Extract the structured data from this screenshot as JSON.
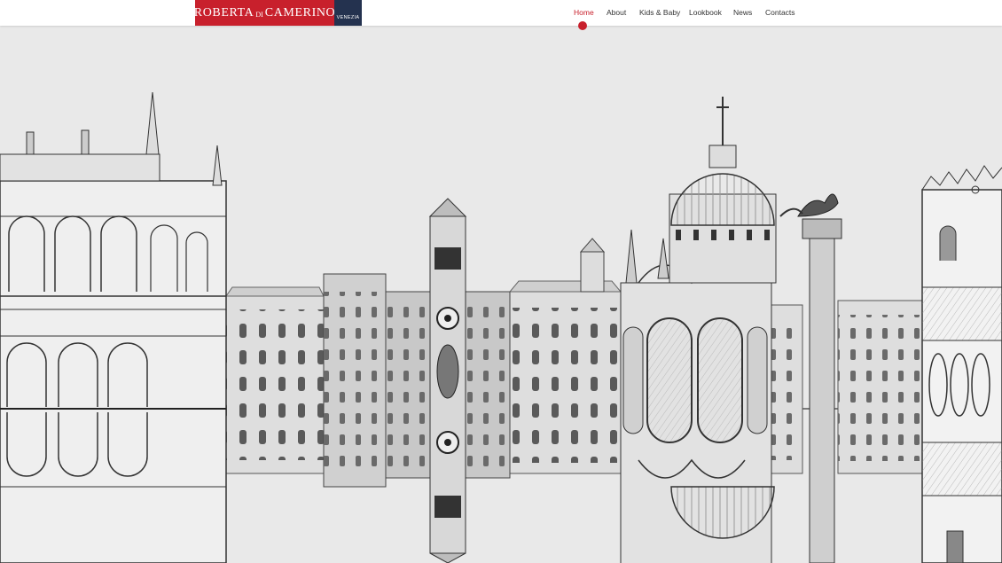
{
  "brand": {
    "name_left": "ROBERTA",
    "name_small": "DI",
    "name_right": "CAMERINO",
    "city": "VENEZIA",
    "colors": {
      "red": "#c8202c",
      "navy": "#24324f"
    }
  },
  "nav": {
    "items": [
      {
        "label": "Home",
        "active": true
      },
      {
        "label": "About",
        "active": false
      },
      {
        "label": "Kids & Baby",
        "active": false
      },
      {
        "label": "Lookbook",
        "active": false
      },
      {
        "label": "News",
        "active": false
      },
      {
        "label": "Contacts",
        "active": false
      }
    ]
  },
  "hero": {
    "illustration": "venice-skyline-mirrored-sketch"
  }
}
